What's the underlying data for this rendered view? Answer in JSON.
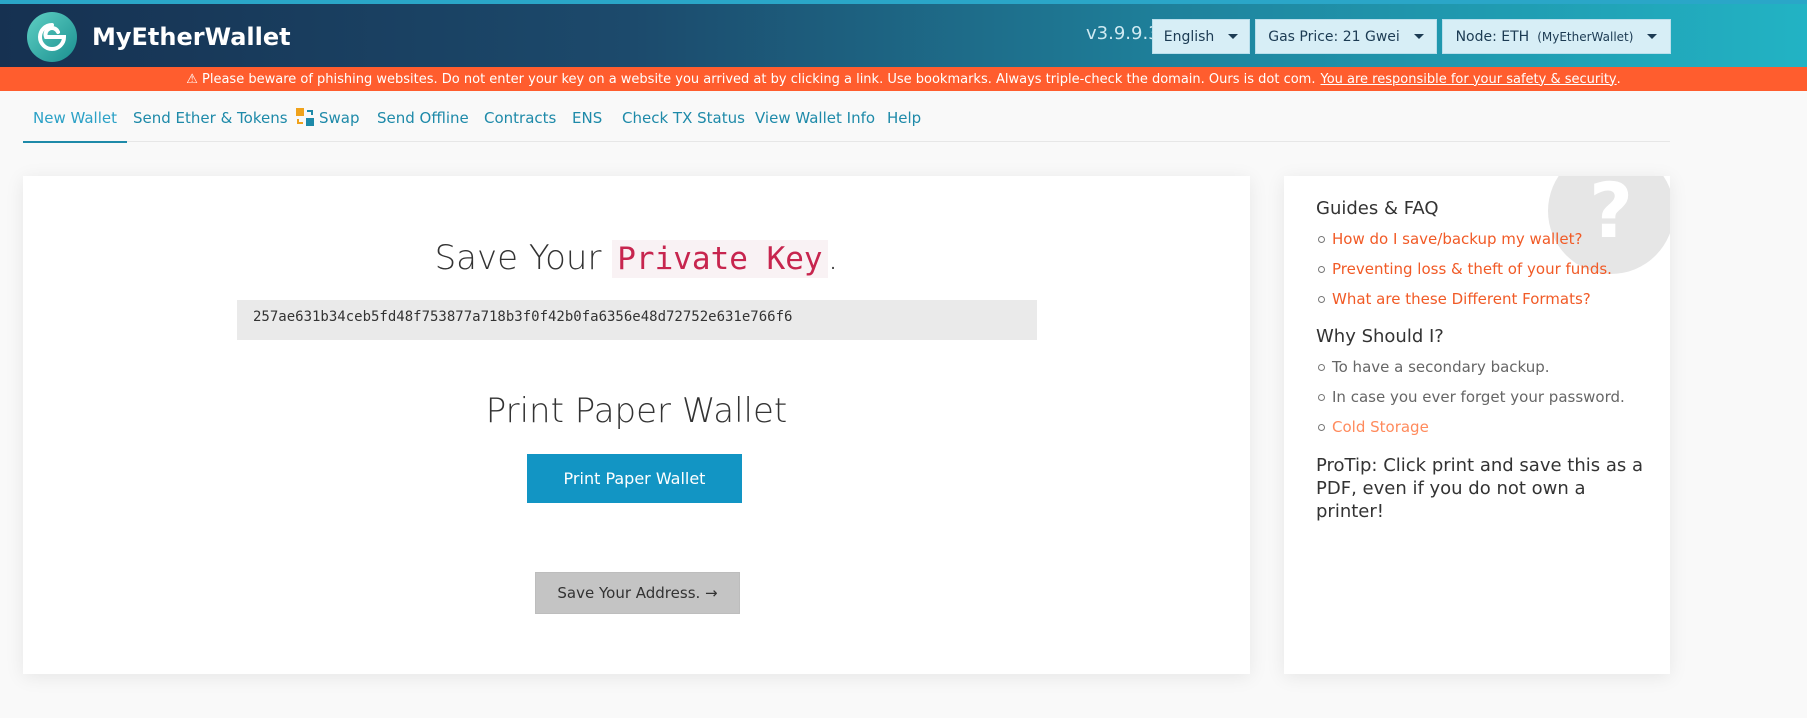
{
  "header": {
    "brand": "MyEtherWallet",
    "version": "v3.9.9.3",
    "language": "English",
    "gas_price": "Gas Price: 21 Gwei",
    "node_label": "Node: ETH",
    "node_sub": "(MyEtherWallet)",
    "gradient_colors": [
      "#163151",
      "#22b3c4"
    ]
  },
  "warning": {
    "text": "⚠ Please beware of phishing websites. Do not enter your key on a website you arrived at by clicking a link. Use bookmarks. Always triple-check the domain. Ours is dot com.",
    "link": "You are responsible for your safety & security",
    "tail": ".",
    "color": "#ff5d2e"
  },
  "nav": {
    "items": [
      {
        "label": "New Wallet",
        "active": true
      },
      {
        "label": "Send Ether & Tokens"
      },
      {
        "label": "Swap",
        "icon": "swap-icon"
      },
      {
        "label": "Send Offline"
      },
      {
        "label": "Contracts"
      },
      {
        "label": "ENS"
      },
      {
        "label": "Check TX Status"
      },
      {
        "label": "View Wallet Info"
      },
      {
        "label": "Help"
      }
    ]
  },
  "main": {
    "save_title": "Save Your",
    "save_title_code": "Private Key",
    "save_title_end": ".",
    "private_key": "257ae631b34ceb5fd48f753877a718b3f0f42b0fa6356e48d72752e631e766f6",
    "print_title": "Print Paper Wallet",
    "print_button": "Print Paper Wallet",
    "address_button": "Save Your Address. →",
    "accent": "#1295c4"
  },
  "sidebar": {
    "help_icon": "question-mark-icon",
    "guides_title": "Guides & FAQ",
    "guides": [
      "How do I save/backup my wallet?",
      "Preventing loss & theft of your funds.",
      "What are these Different Formats?"
    ],
    "why_title": "Why Should I?",
    "why": [
      "To have a secondary backup.",
      "In case you ever forget your password.",
      "Cold Storage"
    ],
    "protip": "ProTip: Click print and save this as a PDF, even if you do not own a printer!"
  }
}
